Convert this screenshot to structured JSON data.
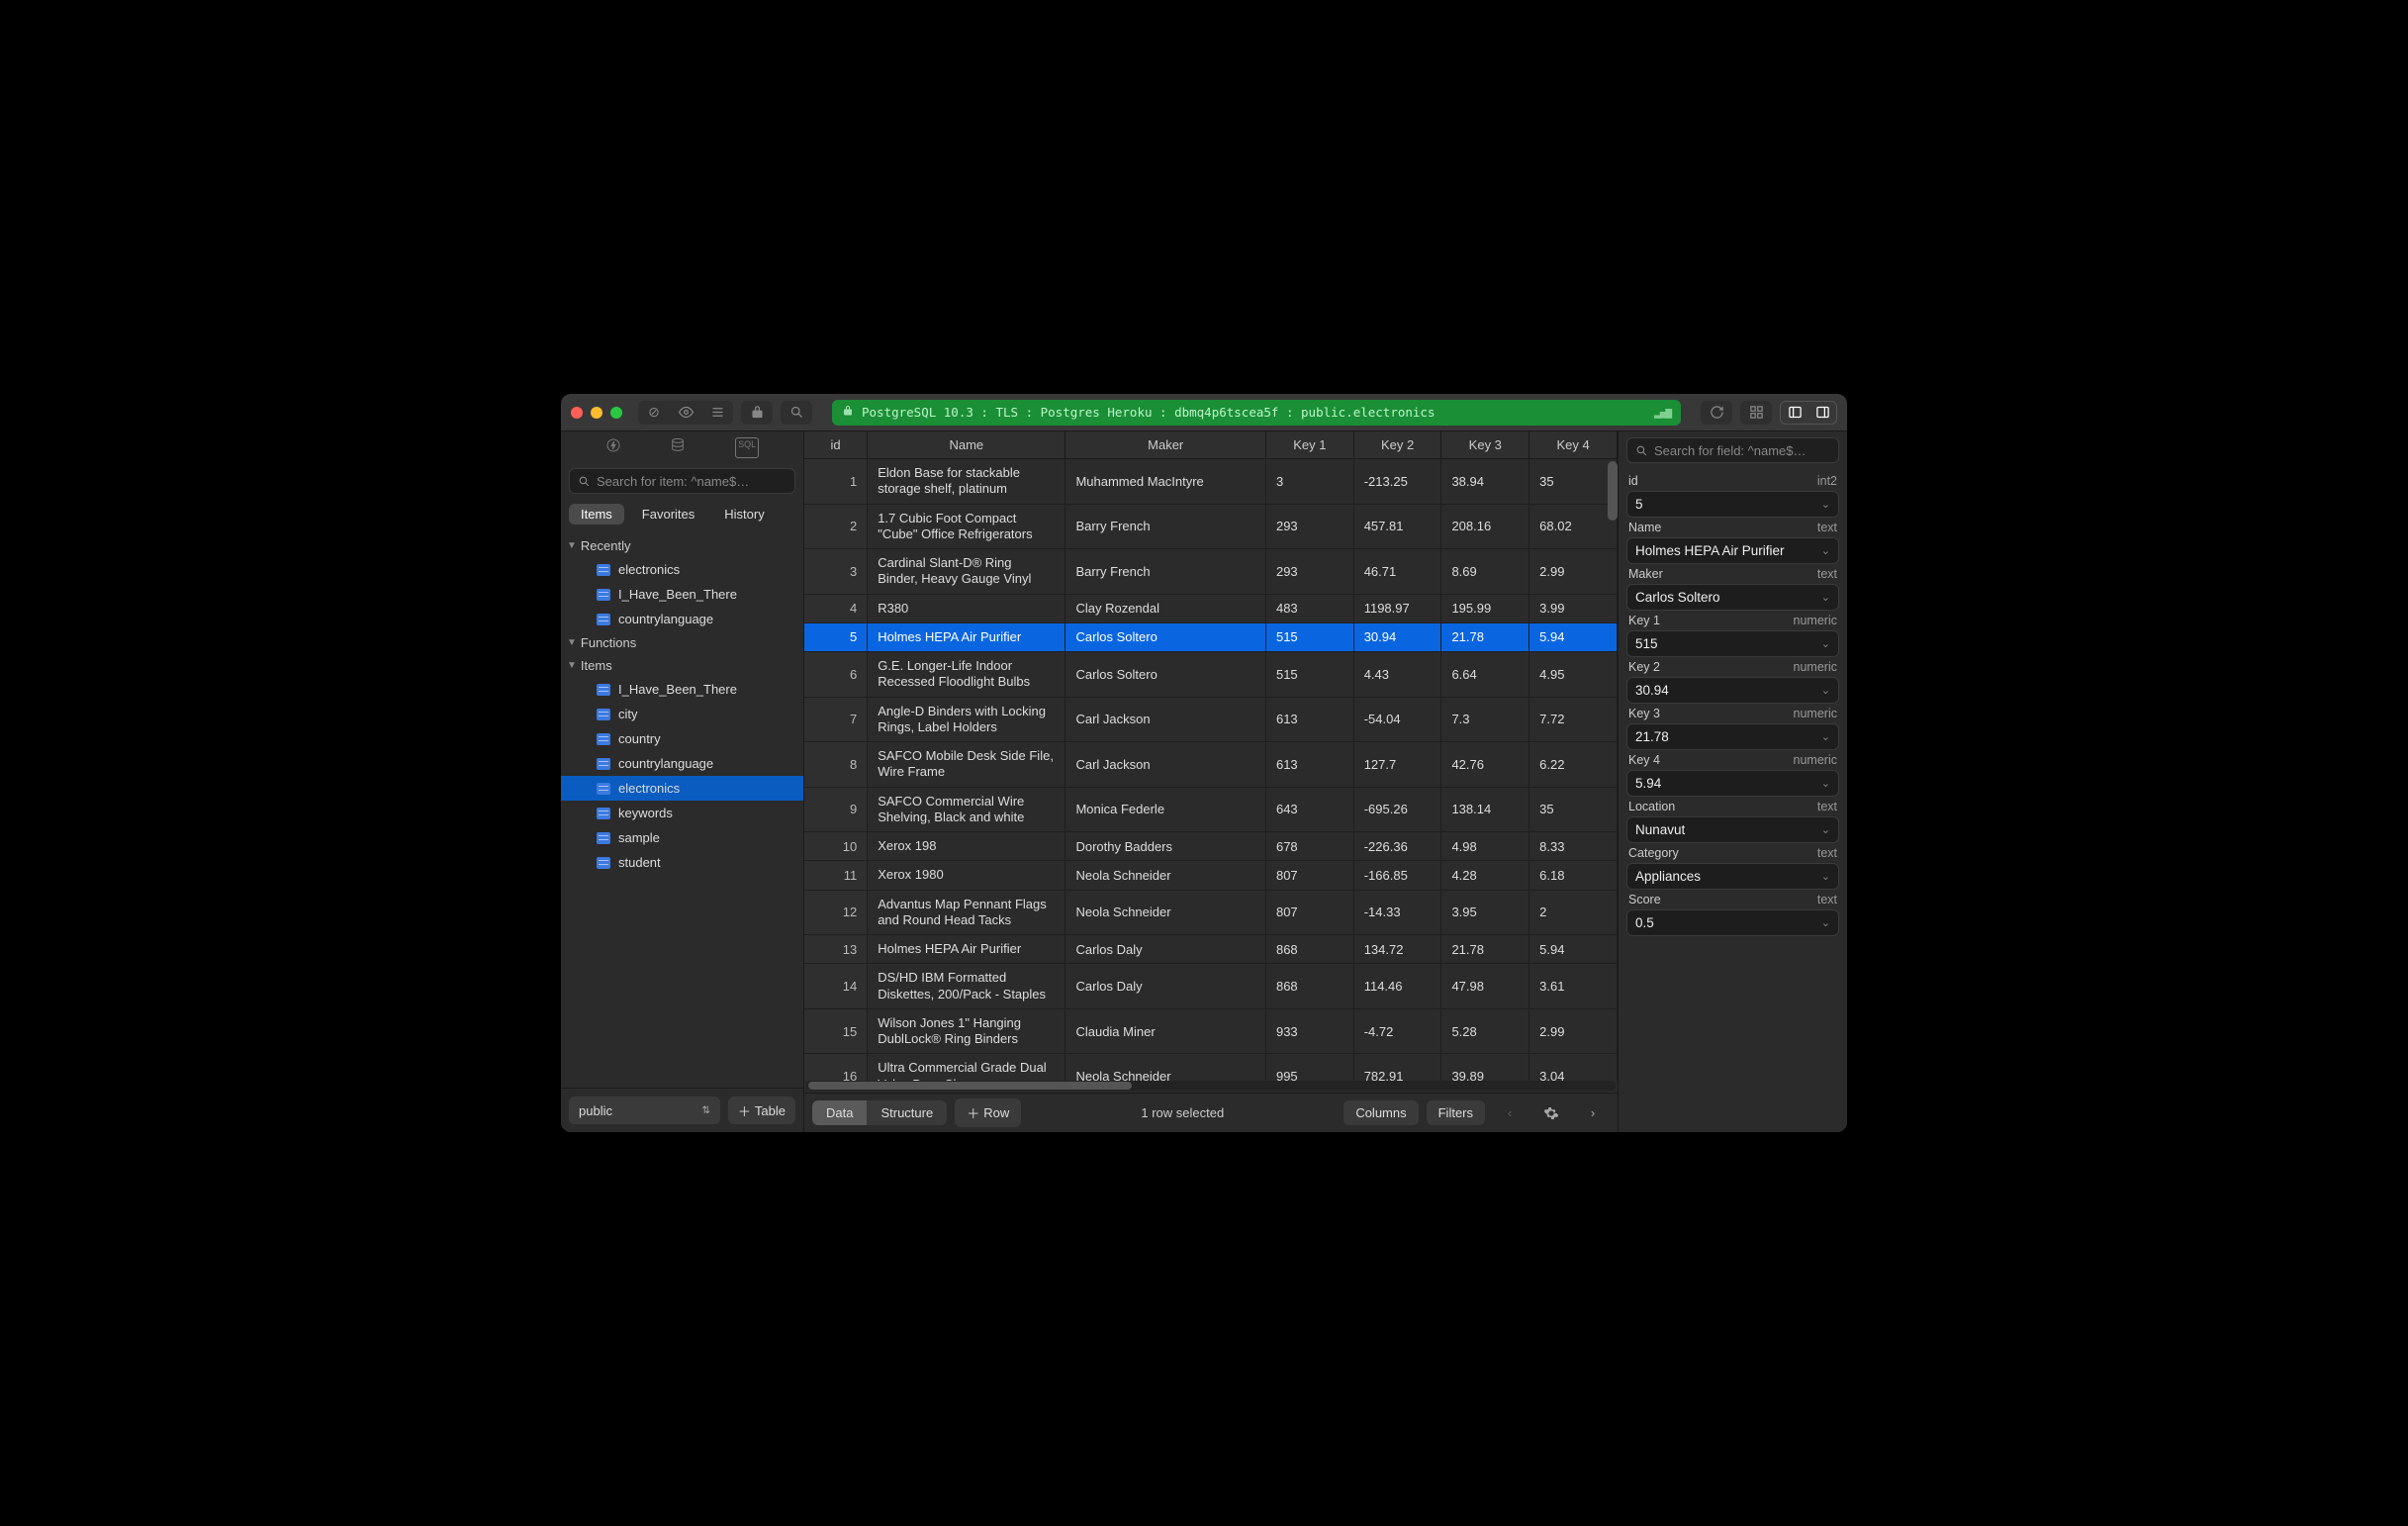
{
  "titlebar": {
    "connection": "PostgreSQL 10.3 : TLS : Postgres Heroku : dbmq4p6tscea5f : public.electronics"
  },
  "sidebar": {
    "search_placeholder": "Search for item: ^name$…",
    "tabs": {
      "items": "Items",
      "favorites": "Favorites",
      "history": "History"
    },
    "sections": {
      "recently": {
        "label": "Recently",
        "items": [
          "electronics",
          "I_Have_Been_There",
          "countrylanguage"
        ]
      },
      "functions": {
        "label": "Functions"
      },
      "items": {
        "label": "Items",
        "items": [
          "I_Have_Been_There",
          "city",
          "country",
          "countrylanguage",
          "electronics",
          "keywords",
          "sample",
          "student"
        ]
      }
    },
    "selected_item": "electronics",
    "schema": "public",
    "add_table": "Table"
  },
  "grid": {
    "columns": [
      "id",
      "Name",
      "Maker",
      "Key 1",
      "Key 2",
      "Key 3",
      "Key 4"
    ],
    "selected_id": 5,
    "rows": [
      {
        "id": 1,
        "name": "Eldon Base for stackable storage shelf, platinum",
        "maker": "Muhammed MacIntyre",
        "k1": "3",
        "k2": "-213.25",
        "k3": "38.94",
        "k4": "35"
      },
      {
        "id": 2,
        "name": "1.7 Cubic Foot Compact \"Cube\" Office Refrigerators",
        "maker": "Barry French",
        "k1": "293",
        "k2": "457.81",
        "k3": "208.16",
        "k4": "68.02"
      },
      {
        "id": 3,
        "name": "Cardinal Slant-D® Ring Binder, Heavy Gauge Vinyl",
        "maker": "Barry French",
        "k1": "293",
        "k2": "46.71",
        "k3": "8.69",
        "k4": "2.99"
      },
      {
        "id": 4,
        "name": "R380",
        "maker": "Clay Rozendal",
        "k1": "483",
        "k2": "1198.97",
        "k3": "195.99",
        "k4": "3.99"
      },
      {
        "id": 5,
        "name": "Holmes HEPA Air Purifier",
        "maker": "Carlos Soltero",
        "k1": "515",
        "k2": "30.94",
        "k3": "21.78",
        "k4": "5.94"
      },
      {
        "id": 6,
        "name": "G.E. Longer-Life Indoor Recessed Floodlight Bulbs",
        "maker": "Carlos Soltero",
        "k1": "515",
        "k2": "4.43",
        "k3": "6.64",
        "k4": "4.95"
      },
      {
        "id": 7,
        "name": "Angle-D Binders with Locking Rings, Label Holders",
        "maker": "Carl Jackson",
        "k1": "613",
        "k2": "-54.04",
        "k3": "7.3",
        "k4": "7.72"
      },
      {
        "id": 8,
        "name": "SAFCO Mobile Desk Side File, Wire Frame",
        "maker": "Carl Jackson",
        "k1": "613",
        "k2": "127.7",
        "k3": "42.76",
        "k4": "6.22"
      },
      {
        "id": 9,
        "name": "SAFCO Commercial Wire Shelving, Black and white",
        "maker": "Monica Federle",
        "k1": "643",
        "k2": "-695.26",
        "k3": "138.14",
        "k4": "35"
      },
      {
        "id": 10,
        "name": "Xerox 198",
        "maker": "Dorothy Badders",
        "k1": "678",
        "k2": "-226.36",
        "k3": "4.98",
        "k4": "8.33"
      },
      {
        "id": 11,
        "name": "Xerox 1980",
        "maker": "Neola Schneider",
        "k1": "807",
        "k2": "-166.85",
        "k3": "4.28",
        "k4": "6.18"
      },
      {
        "id": 12,
        "name": "Advantus Map Pennant Flags and Round Head Tacks",
        "maker": "Neola Schneider",
        "k1": "807",
        "k2": "-14.33",
        "k3": "3.95",
        "k4": "2"
      },
      {
        "id": 13,
        "name": "Holmes HEPA Air Purifier",
        "maker": "Carlos Daly",
        "k1": "868",
        "k2": "134.72",
        "k3": "21.78",
        "k4": "5.94"
      },
      {
        "id": 14,
        "name": "DS/HD IBM Formatted Diskettes, 200/Pack - Staples",
        "maker": "Carlos Daly",
        "k1": "868",
        "k2": "114.46",
        "k3": "47.98",
        "k4": "3.61"
      },
      {
        "id": 15,
        "name": "Wilson Jones 1\" Hanging DublLock® Ring Binders",
        "maker": "Claudia Miner",
        "k1": "933",
        "k2": "-4.72",
        "k3": "5.28",
        "k4": "2.99"
      },
      {
        "id": 16,
        "name": "Ultra Commercial Grade Dual Valve Door Closer",
        "maker": "Neola Schneider",
        "k1": "995",
        "k2": "782.91",
        "k3": "39.89",
        "k4": "3.04"
      }
    ]
  },
  "bottombar": {
    "data": "Data",
    "structure": "Structure",
    "row": "Row",
    "status": "1 row selected",
    "columns": "Columns",
    "filters": "Filters"
  },
  "inspector": {
    "search_placeholder": "Search for field: ^name$…",
    "fields": [
      {
        "label": "id",
        "type": "int2",
        "value": "5"
      },
      {
        "label": "Name",
        "type": "text",
        "value": "Holmes HEPA Air Purifier"
      },
      {
        "label": "Maker",
        "type": "text",
        "value": "Carlos Soltero"
      },
      {
        "label": "Key 1",
        "type": "numeric",
        "value": "515"
      },
      {
        "label": "Key 2",
        "type": "numeric",
        "value": "30.94"
      },
      {
        "label": "Key 3",
        "type": "numeric",
        "value": "21.78"
      },
      {
        "label": "Key 4",
        "type": "numeric",
        "value": "5.94"
      },
      {
        "label": "Location",
        "type": "text",
        "value": "Nunavut"
      },
      {
        "label": "Category",
        "type": "text",
        "value": "Appliances"
      },
      {
        "label": "Score",
        "type": "text",
        "value": "0.5"
      }
    ]
  }
}
